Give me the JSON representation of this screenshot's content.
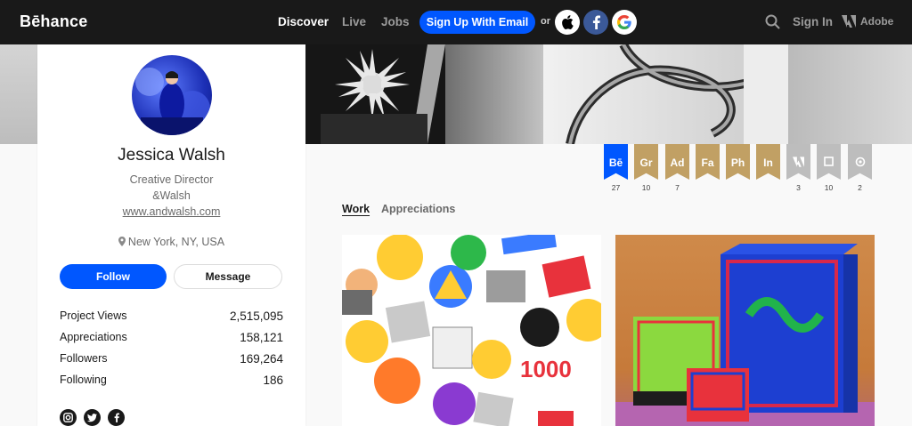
{
  "nav": {
    "logo": "Bēhance",
    "links": [
      "Discover",
      "Live",
      "Jobs"
    ],
    "signup_label": "Sign Up With Email",
    "or_label": "or",
    "signin_label": "Sign In",
    "adobe_label": "Adobe"
  },
  "profile": {
    "name": "Jessica Walsh",
    "occupation": "Creative Director",
    "company": "&Walsh",
    "website": "www.andwalsh.com",
    "location": "New York, NY, USA",
    "follow_label": "Follow",
    "message_label": "Message",
    "stats": [
      {
        "label": "Project Views",
        "value": "2,515,095"
      },
      {
        "label": "Appreciations",
        "value": "158,121"
      },
      {
        "label": "Followers",
        "value": "169,264"
      },
      {
        "label": "Following",
        "value": "186"
      }
    ]
  },
  "badges": [
    {
      "label": "Bē",
      "count": "27",
      "color": "#0057ff"
    },
    {
      "label": "Gr",
      "count": "10",
      "color": "#c1a064"
    },
    {
      "label": "Ad",
      "count": "7",
      "color": "#c1a064"
    },
    {
      "label": "Fa",
      "count": "",
      "color": "#c1a064"
    },
    {
      "label": "Ph",
      "count": "",
      "color": "#c1a064"
    },
    {
      "label": "In",
      "count": "",
      "color": "#c1a064"
    },
    {
      "label": "",
      "count": "3",
      "color": "#bdbdbd",
      "icon": "adobe-icon"
    },
    {
      "label": "",
      "count": "10",
      "color": "#bdbdbd",
      "icon": "square-icon"
    },
    {
      "label": "",
      "count": "2",
      "color": "#bdbdbd",
      "icon": "cc-icon"
    }
  ],
  "tabs": [
    "Work",
    "Appreciations"
  ],
  "colors": {
    "accent": "#0057ff",
    "nav_bg": "#191919",
    "badge_gold": "#c1a064"
  }
}
